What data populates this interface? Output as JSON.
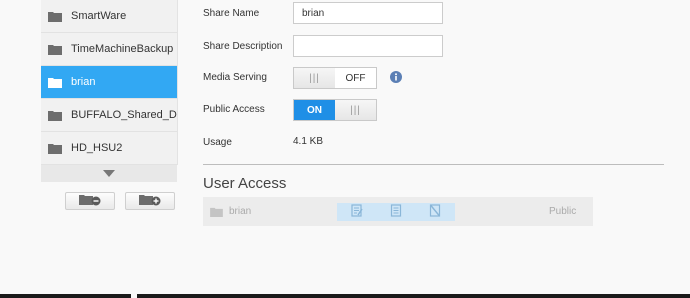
{
  "shares": [
    {
      "label": "SmartWare",
      "selected": false
    },
    {
      "label": "TimeMachineBackup",
      "selected": false
    },
    {
      "label": "brian",
      "selected": true
    },
    {
      "label": "BUFFALO_Shared_Drive",
      "selected": false
    },
    {
      "label": "HD_HSU2",
      "selected": false
    }
  ],
  "form": {
    "share_name_label": "Share Name",
    "share_name_value": "brian",
    "share_description_label": "Share Description",
    "share_description_value": "",
    "media_serving_label": "Media Serving",
    "media_serving_state": "OFF",
    "media_serving_grip": "|||",
    "public_access_label": "Public Access",
    "public_access_state": "ON",
    "public_access_grip": "|||",
    "usage_label": "Usage",
    "usage_value": "4.1 KB"
  },
  "user_access": {
    "title": "User Access",
    "rows": [
      {
        "name": "brian",
        "level": "Public"
      }
    ]
  },
  "colors": {
    "accent": "#32a8f3",
    "toggle_on": "#1f8fe6",
    "info": "#5b7fb5"
  },
  "icons": {
    "folder": "folder-icon",
    "remove_share": "folder-remove-icon",
    "add_share": "folder-add-icon",
    "info": "info-icon",
    "scroll_down": "chevron-down-icon"
  }
}
